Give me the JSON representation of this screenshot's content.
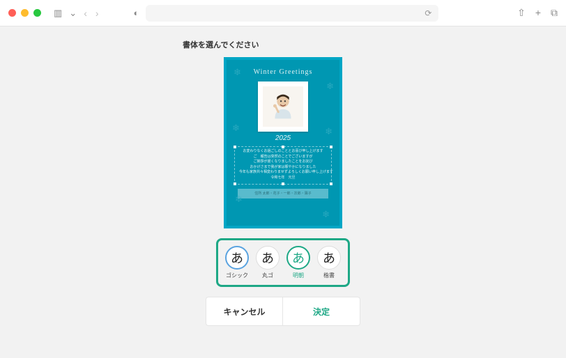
{
  "prompt": "書体を選んでください",
  "card": {
    "title": "Winter Greetings",
    "year": "2025",
    "greeting_lines": [
      "お変わりなくお過ごしのこととお喜び申し上げます",
      "ご　報告は突然のことでございますが",
      "ご挨拶が遅くなりましたことをお詫び",
      "おかげさまで我が家は賑やかになりました",
      "今年も家族共々相変わりませずよろしくお願い申し上げます",
      "令和七年　元旦"
    ],
    "address_label": "住所 太郎・花子・一郎・次郎・陽子"
  },
  "fonts": {
    "options": [
      {
        "glyph": "あ",
        "label": "ゴシック"
      },
      {
        "glyph": "あ",
        "label": "丸ゴ"
      },
      {
        "glyph": "あ",
        "label": "明朝"
      },
      {
        "glyph": "あ",
        "label": "楷書"
      }
    ]
  },
  "actions": {
    "cancel": "キャンセル",
    "confirm": "決定"
  },
  "icons": {
    "sidebar": "▥",
    "dropdown": "⌄",
    "back": "‹",
    "forward": "›",
    "shield": "◐",
    "refresh": "⟳",
    "share": "⇧",
    "add": "+",
    "tabs": "⧉"
  }
}
